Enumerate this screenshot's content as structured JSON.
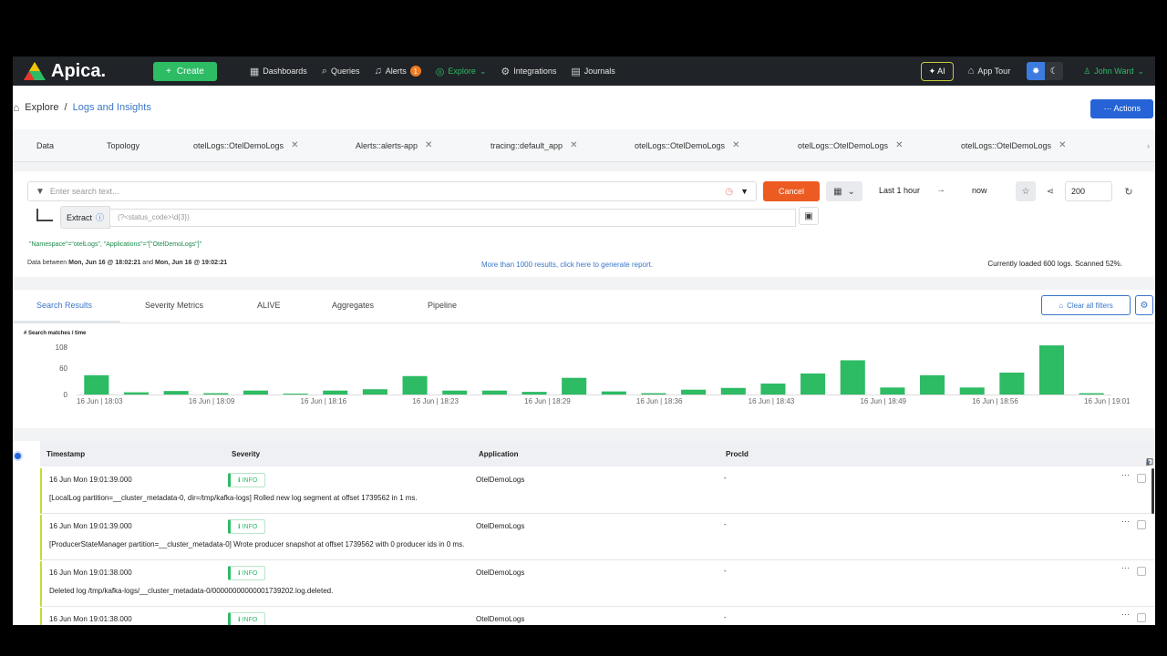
{
  "app": {
    "brand": "Apica."
  },
  "nav": {
    "create_label": "Create",
    "items": [
      {
        "label": "Dashboards",
        "icon": "dashboard-icon"
      },
      {
        "label": "Queries",
        "icon": "search-icon"
      },
      {
        "label": "Alerts",
        "icon": "bell-icon",
        "badge": "1"
      },
      {
        "label": "Explore",
        "icon": "compass-icon"
      },
      {
        "label": "Integrations",
        "icon": "puzzle-icon"
      },
      {
        "label": "Journals",
        "icon": "book-icon"
      }
    ],
    "ai_label": "AI",
    "app_tour_label": "App Tour",
    "user_name": "John Ward",
    "accent_color": "#2dbb64"
  },
  "breadcrumb": {
    "root": "Explore",
    "separator": "/",
    "current": "Logs and Insights"
  },
  "actions_label": "Actions",
  "tabs": [
    {
      "label": "Data",
      "closable": false
    },
    {
      "label": "Topology",
      "closable": false
    },
    {
      "label": "otelLogs::OtelDemoLogs",
      "closable": true
    },
    {
      "label": "Alerts::alerts-app",
      "closable": true
    },
    {
      "label": "tracing::default_app",
      "closable": true
    },
    {
      "label": "otelLogs::OtelDemoLogs",
      "closable": true
    },
    {
      "label": "otelLogs::OtelDemoLogs",
      "closable": true
    },
    {
      "label": "otelLogs::OtelDemoLogs",
      "closable": true
    }
  ],
  "search": {
    "placeholder": "Enter search text...",
    "cancel_label": "Cancel",
    "time_from": "Last 1 hour",
    "time_to": "now",
    "limit": "200",
    "extract_label": "Extract",
    "extract_placeholder": "(?<status_code>\\d{3})",
    "query": "\"Namespace\"=\"otelLogs\", \"Applications\"=\"[\"OtelDemoLogs\"]\"",
    "data_between_prefix": "Data between",
    "data_from": "Mon, Jun 16 @ 18:02:21",
    "data_and": "and",
    "data_to": "Mon, Jun 16 @ 19:02:21",
    "report_link": "More than 1000 results, click here to generate report.",
    "loaded_status": "Currently loaded 600 logs.  Scanned 52%."
  },
  "result_tabs": [
    {
      "label": "Search Results",
      "active": true
    },
    {
      "label": "Severity Metrics",
      "active": false
    },
    {
      "label": "ALIVE",
      "active": false
    },
    {
      "label": "Aggregates",
      "active": false
    },
    {
      "label": "Pipeline",
      "active": false
    }
  ],
  "clear_filters_label": "Clear all filters",
  "chart_data": {
    "type": "bar",
    "title": "# Search matches / time",
    "ylim": [
      0,
      108
    ],
    "yticks": [
      "108",
      "60",
      "0"
    ],
    "xticks": [
      "16 Jun | 18:03",
      "16 Jun | 18:09",
      "16 Jun | 18:16",
      "16 Jun | 18:23",
      "16 Jun | 18:29",
      "16 Jun | 18:36",
      "16 Jun | 18:43",
      "16 Jun | 18:49",
      "16 Jun | 18:56",
      "16 Jun | 19:01"
    ],
    "values": [
      44,
      5,
      8,
      3,
      9,
      1,
      9,
      12,
      42,
      9,
      9,
      6,
      38,
      7,
      3,
      11,
      15,
      25,
      48,
      78,
      16,
      44,
      16,
      50,
      112,
      3
    ],
    "bar_color": "#2dbb64",
    "grid": false
  },
  "table": {
    "columns": [
      "Timestamp",
      "Severity",
      "Application",
      "ProcId"
    ],
    "rows": [
      {
        "timestamp": "16  Jun  Mon  19:01:39.000",
        "severity": "INFO",
        "application": "OtelDemoLogs",
        "procid": "-",
        "message": "[LocalLog partition=__cluster_metadata-0, dir=/tmp/kafka-logs] Rolled new log segment at offset 1739562 in 1 ms."
      },
      {
        "timestamp": "16  Jun  Mon  19:01:39.000",
        "severity": "INFO",
        "application": "OtelDemoLogs",
        "procid": "-",
        "message": "[ProducerStateManager partition=__cluster_metadata-0] Wrote producer snapshot at offset 1739562 with 0 producer ids in 0 ms."
      },
      {
        "timestamp": "16  Jun  Mon  19:01:38.000",
        "severity": "INFO",
        "application": "OtelDemoLogs",
        "procid": "-",
        "message": "Deleted log /tmp/kafka-logs/__cluster_metadata-0/00000000000001739202.log.deleted."
      },
      {
        "timestamp": "16  Jun  Mon  19:01:38.000",
        "severity": "INFO",
        "application": "OtelDemoLogs",
        "procid": "-",
        "message": ""
      }
    ]
  }
}
